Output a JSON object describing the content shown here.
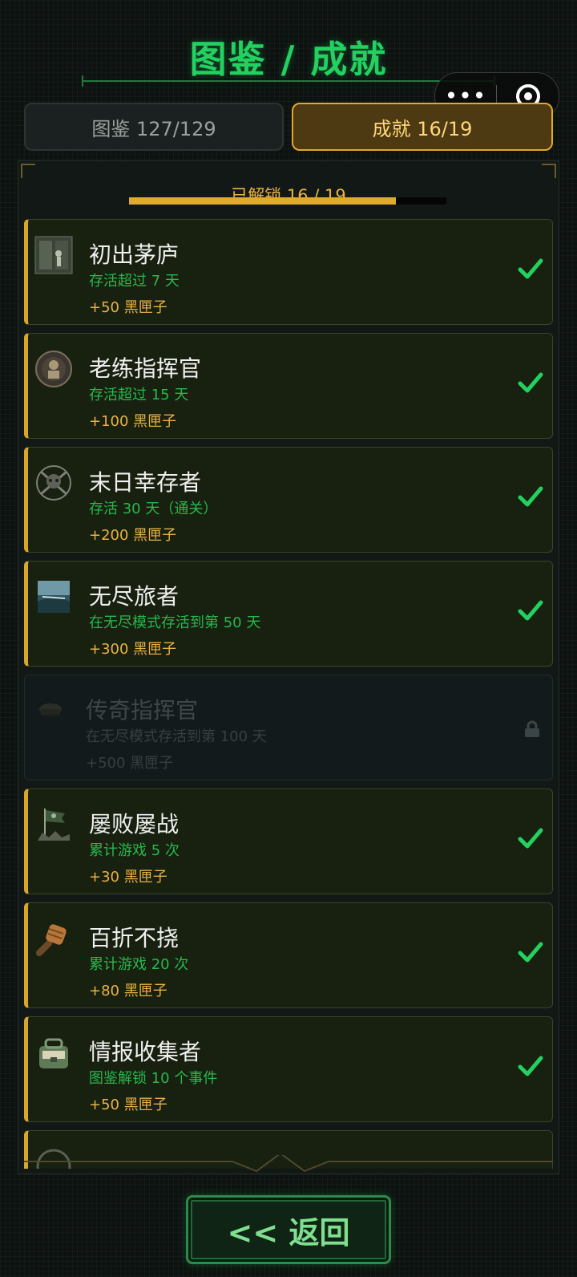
{
  "header": {
    "title": "图鉴 / 成就"
  },
  "capsule": {
    "more_label": "•••"
  },
  "tabs": [
    {
      "label": "图鉴 127/129",
      "active": false
    },
    {
      "label": "成就 16/19",
      "active": true
    }
  ],
  "progress": {
    "label": "已解锁 16 / 19",
    "unlocked": 16,
    "total": 19,
    "fraction": 0.842
  },
  "achievements": [
    {
      "name": "初出茅庐",
      "condition": "存活超过 7 天",
      "reward": "+50 黑匣子",
      "unlocked": true,
      "icon": "survivor-door-icon"
    },
    {
      "name": "老练指挥官",
      "condition": "存活超过 15 天",
      "reward": "+100 黑匣子",
      "unlocked": true,
      "icon": "commander-medal-icon"
    },
    {
      "name": "末日幸存者",
      "condition": "存活 30 天（通关）",
      "reward": "+200 黑匣子",
      "unlocked": true,
      "icon": "skull-emblem-icon"
    },
    {
      "name": "无尽旅者",
      "condition": "在无尽模式存活到第 50 天",
      "reward": "+300 黑匣子",
      "unlocked": true,
      "icon": "landscape-icon"
    },
    {
      "name": "传奇指挥官",
      "condition": "在无尽模式存活到第 100 天",
      "reward": "+500 黑匣子",
      "unlocked": false,
      "icon": "officer-cap-icon"
    },
    {
      "name": "屡败屡战",
      "condition": "累计游戏 5 次",
      "reward": "+30 黑匣子",
      "unlocked": true,
      "icon": "flag-rubble-icon"
    },
    {
      "name": "百折不挠",
      "condition": "累计游戏 20 次",
      "reward": "+80 黑匣子",
      "unlocked": true,
      "icon": "raised-fist-icon"
    },
    {
      "name": "情报收集者",
      "condition": "图鉴解锁 10 个事件",
      "reward": "+50 黑匣子",
      "unlocked": true,
      "icon": "intel-bag-icon"
    }
  ],
  "footer": {
    "back_label": "<< 返回"
  },
  "colors": {
    "accent_green": "#23d160",
    "gold": "#e0aa2c",
    "background": "#0d1210"
  }
}
